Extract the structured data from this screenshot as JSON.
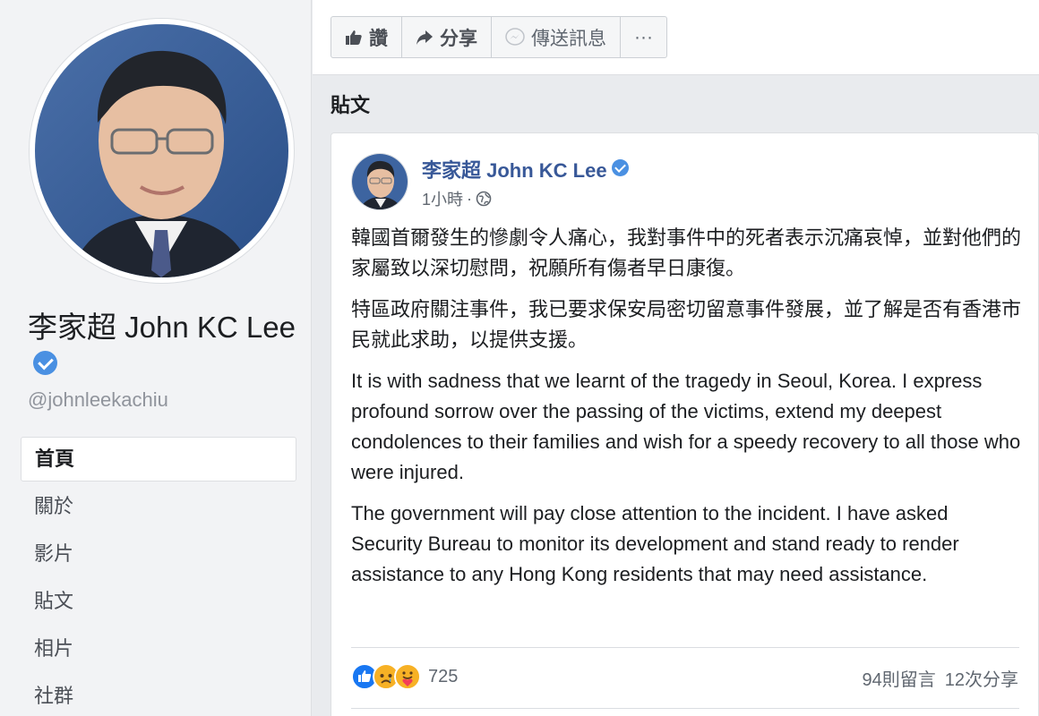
{
  "page": {
    "name": "李家超 John KC Lee",
    "handle": "@johnleekachiu"
  },
  "nav": {
    "items": [
      {
        "label": "首頁"
      },
      {
        "label": "關於"
      },
      {
        "label": "影片"
      },
      {
        "label": "貼文"
      },
      {
        "label": "相片"
      },
      {
        "label": "社群"
      }
    ]
  },
  "toolbar": {
    "like_label": "讚",
    "share_label": "分享",
    "message_label": "傳送訊息",
    "more_label": "···"
  },
  "posts_section": {
    "title": "貼文"
  },
  "post": {
    "author": "李家超 John KC Lee",
    "time": "1小時",
    "dot": "·",
    "paragraphs": [
      "韓國首爾發生的慘劇令人痛心，我對事件中的死者表示沉痛哀悼，並對他們的家屬致以深切慰問，祝願所有傷者早日康復。",
      "特區政府關注事件，我已要求保安局密切留意事件發展，並了解是否有香港市民就此求助，以提供支援。",
      "It is with sadness that we learnt of the tragedy in Seoul, Korea. I express profound sorrow over the passing of the victims, extend my deepest condolences to their families and wish for a speedy recovery to all those who were injured.",
      "The government will pay close attention to the incident. I have asked Security Bureau to monitor its development and stand ready to render assistance to any Hong Kong residents that may need assistance."
    ],
    "reaction_count": "725",
    "comments": "94則留言",
    "shares": "12次分享"
  },
  "colors": {
    "link": "#385898",
    "verified": "#4a90e2",
    "like": "#1877f2"
  },
  "icons": {
    "like": "thumbs-up-icon",
    "share": "share-arrow-icon",
    "message": "messenger-icon",
    "audience": "globe-icon"
  }
}
